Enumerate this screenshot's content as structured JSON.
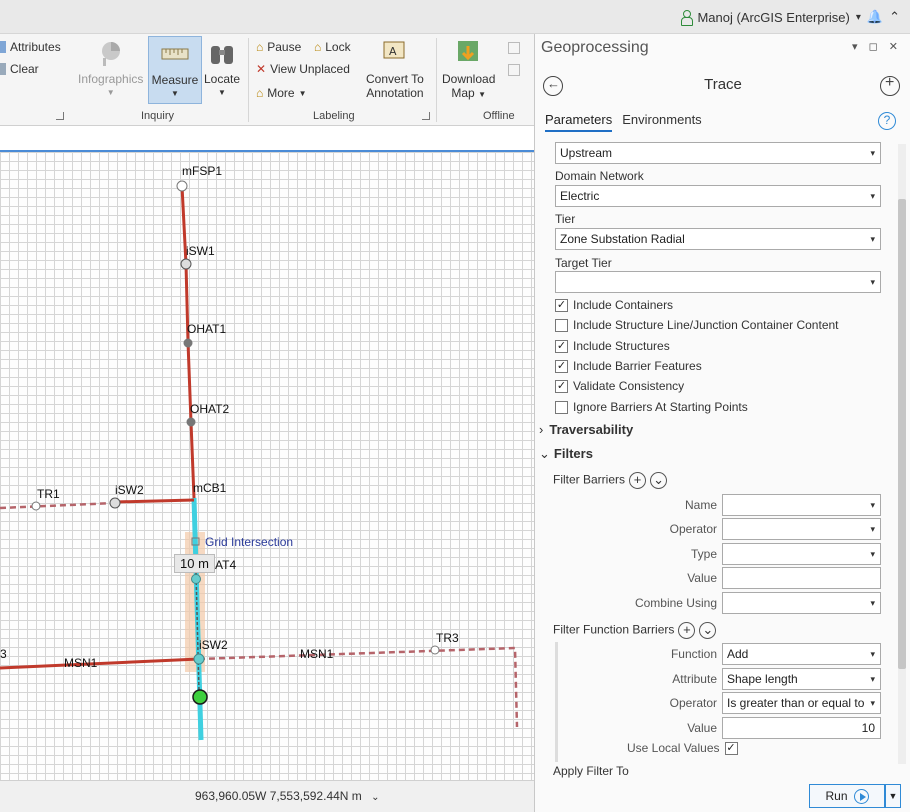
{
  "titlebar": {
    "user": "Manoj (ArcGIS Enterprise)",
    "user_caret": "▾",
    "bell": "🔔",
    "collapse": "⌃"
  },
  "ribbon": {
    "attributes": "Attributes",
    "clear": "Clear",
    "infographics": "Infographics",
    "measure": "Measure",
    "locate": "Locate",
    "pause": "Pause",
    "lock": "Lock",
    "view_unplaced": "View Unplaced",
    "more": "More",
    "convert_line1": "Convert To",
    "convert_line2": "Annotation",
    "download_line1": "Download",
    "download_line2": "Map",
    "groups": {
      "inquiry": "Inquiry",
      "labeling": "Labeling",
      "offline": "Offline"
    }
  },
  "map": {
    "labels": {
      "mfsp1": "mFSP1",
      "isw1": "iSW1",
      "ohat1": "OHAT1",
      "ohat2": "OHAT2",
      "mcb1": "mCB1",
      "tr1": "TR1",
      "isw2_left": "iSW2",
      "grid": "Grid Intersection",
      "measure": "10 m",
      "at4": "AT4",
      "isw2_bottom": "iSW2",
      "msn1_left": "MSN1",
      "msn1_right": "MSN1",
      "tr3": "TR3",
      "left_edge": "3"
    },
    "coords": "963,960.05W 7,553,592.44N m"
  },
  "geoprocessing": {
    "title": "Geoprocessing",
    "window_controls": "▾ ◻ ✕",
    "tool": "Trace",
    "tabs": {
      "parameters": "Parameters",
      "environments": "Environments"
    },
    "help": "?",
    "direction": "Upstream",
    "domain_network_label": "Domain Network",
    "domain_network": "Electric",
    "tier_label": "Tier",
    "tier": "Zone Substation Radial",
    "target_tier_label": "Target Tier",
    "target_tier": "",
    "checks": {
      "include_containers": "Include Containers",
      "include_structure_line": "Include Structure Line/Junction Container Content",
      "include_structures": "Include Structures",
      "include_barrier_features": "Include Barrier Features",
      "validate_consistency": "Validate Consistency",
      "ignore_barriers": "Ignore Barriers At Starting Points"
    },
    "traversability": "Traversability",
    "filters": "Filters",
    "filter_barriers": "Filter Barriers",
    "fb": {
      "name": "Name",
      "operator": "Operator",
      "type": "Type",
      "value": "Value",
      "combine": "Combine Using"
    },
    "filter_function_barriers": "Filter Function Barriers",
    "ffb": {
      "function_label": "Function",
      "function": "Add",
      "attribute_label": "Attribute",
      "attribute": "Shape length",
      "operator_label": "Operator",
      "operator": "Is greater than or equal to",
      "value_label": "Value",
      "value": "10",
      "use_local": "Use Local Values"
    },
    "apply_filter_to": "Apply Filter To",
    "run": "Run"
  }
}
